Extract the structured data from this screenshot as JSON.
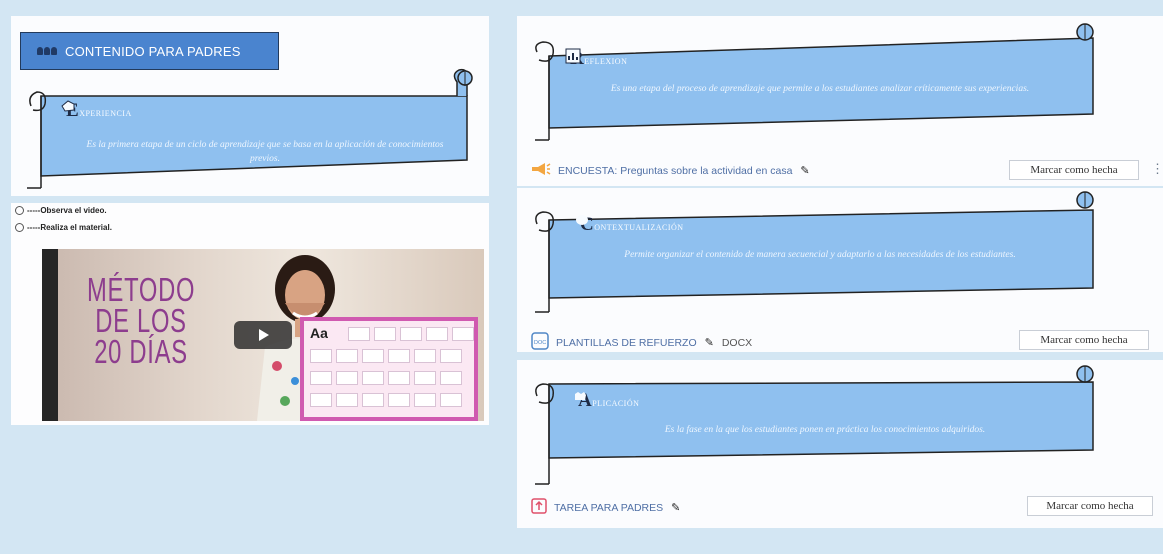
{
  "header": {
    "title": "CONTENIDO PARA PADRES",
    "icon": "users-icon"
  },
  "experiencia": {
    "cap": "E",
    "rest": "xperiencia",
    "description": "Es la primera etapa de un ciclo de aprendizaje que se basa en la aplicación de conocimientos previos."
  },
  "video": {
    "line1": "-----Observa el video.",
    "line2": "-----Realiza el material.",
    "thumb_title_line1": "MÉTODO",
    "thumb_title_line2": "DE LOS",
    "thumb_title_line3": "20 DÍAS",
    "board_label": "Aa"
  },
  "reflexion": {
    "cap": "R",
    "rest": "eflexion",
    "description": "Es una etapa del proceso de aprendizaje que permite a los estudiantes analizar críticamente sus experiencias."
  },
  "activity1": {
    "icon": "megaphone-icon",
    "label": "ENCUESTA: Preguntas sobre la actividad en casa",
    "button": "Marcar como hecha"
  },
  "contextualizacion": {
    "cap": "C",
    "rest": "ontextualización",
    "description": "Permite organizar el contenido de manera secuencial y adaptarlo a las necesidades de los estudiantes."
  },
  "activity2": {
    "icon": "docx-icon",
    "label": "PLANTILLAS DE REFUERZO",
    "suffix": "DOCX",
    "button": "Marcar como hecha"
  },
  "aplicacion": {
    "cap": "A",
    "rest": "plicación",
    "description": "Es la fase en la que los estudiantes ponen en práctica los conocimientos adquiridos."
  },
  "activity3": {
    "icon": "upload-icon",
    "label": "TAREA PARA PADRES",
    "button": "Marcar como hecha"
  },
  "colors": {
    "accent": "#4a84cf",
    "scroll": "#8fc0ef",
    "link": "#4f6fa5"
  }
}
